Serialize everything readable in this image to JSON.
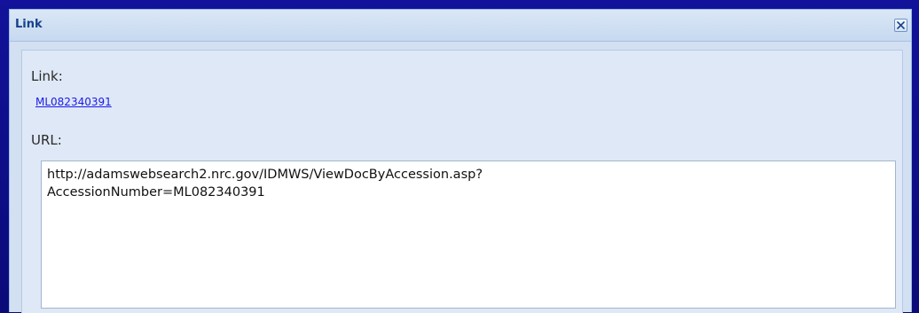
{
  "window": {
    "title": "Link",
    "close_icon": "close-icon"
  },
  "link_section": {
    "label": "Link:",
    "link_text": "ML082340391"
  },
  "url_section": {
    "label": "URL:",
    "value": "http://adamswebsearch2.nrc.gov/IDMWS/ViewDocByAccession.asp?\nAccessionNumber=ML082340391"
  },
  "colors": {
    "title_text": "#15428b",
    "panel_bg": "#dfe8f6",
    "link": "#1a1ae6",
    "backdrop": "#0b0b7a"
  }
}
